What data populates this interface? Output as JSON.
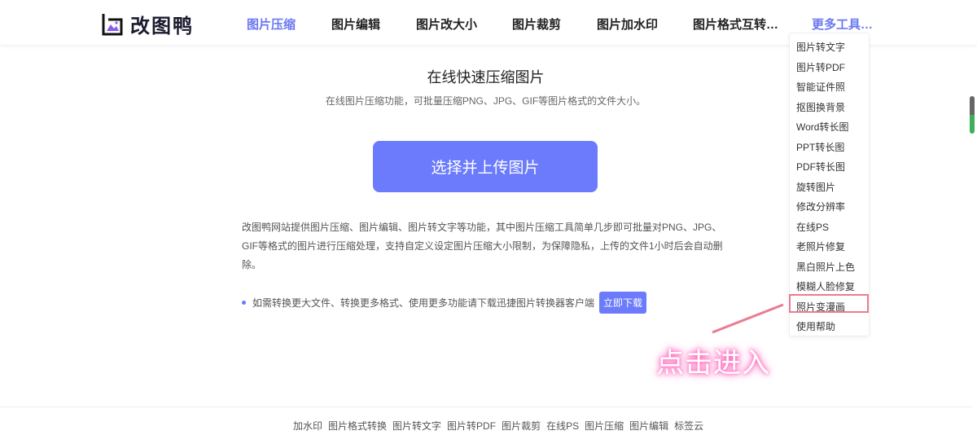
{
  "header": {
    "logo_text": "改图鸭",
    "nav": [
      {
        "label": "图片压缩",
        "active": true
      },
      {
        "label": "图片编辑"
      },
      {
        "label": "图片改大小"
      },
      {
        "label": "图片裁剪"
      },
      {
        "label": "图片加水印"
      },
      {
        "label": "图片格式互转…"
      },
      {
        "label": "更多工具…",
        "active": true
      }
    ]
  },
  "dropdown": [
    "图片转文字",
    "图片转PDF",
    "智能证件照",
    "抠图换背景",
    "Word转长图",
    "PPT转长图",
    "PDF转长图",
    "旋转图片",
    "修改分辨率",
    "在线PS",
    "老照片修复",
    "黑白照片上色",
    "模糊人脸修复",
    "照片变漫画",
    "使用帮助"
  ],
  "main": {
    "title": "在线快速压缩图片",
    "subtitle": "在线图片压缩功能，可批量压缩PNG、JPG、GIF等图片格式的文件大小。",
    "upload_label": "选择并上传图片",
    "description": "改图鸭网站提供图片压缩、图片编辑、图片转文字等功能，其中图片压缩工具简单几步即可批量对PNG、JPG、GIF等格式的图片进行压缩处理，支持自定义设定图片压缩大小限制，为保障隐私，上传的文件1小时后会自动删除。",
    "note": "如需转换更大文件、转换更多格式、使用更多功能请下载迅捷图片转换器客户端",
    "download_label": "立即下载"
  },
  "footer": [
    "加水印",
    "图片格式转换",
    "图片转文字",
    "图片转PDF",
    "图片裁剪",
    "在线PS",
    "图片压缩",
    "图片编辑",
    "标签云"
  ],
  "annotation": "点击进入",
  "colors": {
    "accent": "#6b7bfb",
    "highlight": "#ec7b92"
  }
}
